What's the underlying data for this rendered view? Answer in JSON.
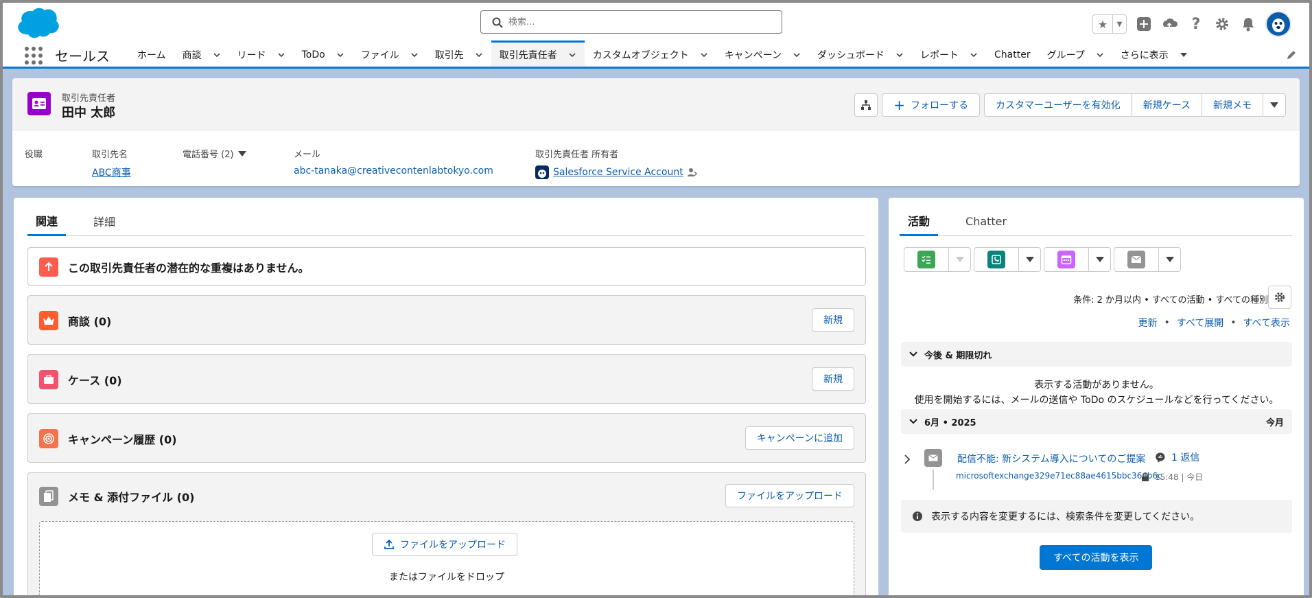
{
  "search": {
    "placeholder": "検索..."
  },
  "app": {
    "name": "セールス"
  },
  "nav": {
    "items": [
      {
        "label": "ホーム",
        "chevron": false
      },
      {
        "label": "商談",
        "chevron": true
      },
      {
        "label": "リード",
        "chevron": true
      },
      {
        "label": "ToDo",
        "chevron": true
      },
      {
        "label": "ファイル",
        "chevron": true
      },
      {
        "label": "取引先",
        "chevron": true
      },
      {
        "label": "取引先責任者",
        "chevron": true,
        "active": true
      },
      {
        "label": "カスタムオブジェクト",
        "chevron": true
      },
      {
        "label": "キャンペーン",
        "chevron": true
      },
      {
        "label": "ダッシュボード",
        "chevron": true
      },
      {
        "label": "レポート",
        "chevron": true
      },
      {
        "label": "Chatter",
        "chevron": false
      },
      {
        "label": "グループ",
        "chevron": true
      },
      {
        "label": "さらに表示",
        "chevron": "caret"
      }
    ]
  },
  "record": {
    "type": "取引先責任者",
    "name": "田中 太郎",
    "actions": {
      "follow": "フォローする",
      "enable_customer": "カスタマーユーザーを有効化",
      "new_case": "新規ケース",
      "new_note": "新規メモ"
    },
    "fields": {
      "title_label": "役職",
      "account_label": "取引先名",
      "account_value": "ABC商事",
      "phone_label": "電話番号 (2)",
      "email_label": "メール",
      "email_value": "abc-tanaka@creativecontenlabtokyo.com",
      "owner_label": "取引先責任者 所有者",
      "owner_value": "Salesforce Service Account"
    }
  },
  "left": {
    "tabs": [
      "関連",
      "詳細"
    ],
    "duplicate_msg": "この取引先責任者の潜在的な重複はありません。",
    "cards": {
      "opps": {
        "title": "商談 (0)",
        "button": "新規"
      },
      "cases": {
        "title": "ケース (0)",
        "button": "新規"
      },
      "campaign": {
        "title": "キャンペーン履歴 (0)",
        "button": "キャンペーンに追加"
      },
      "notes": {
        "title": "メモ & 添付ファイル (0)",
        "button": "ファイルをアップロード",
        "upload": "ファイルをアップロード",
        "drop": "またはファイルをドロップ"
      }
    }
  },
  "activity": {
    "tabs": [
      "活動",
      "Chatter"
    ],
    "filter": "条件: 2 か月以内 • すべての活動 • すべての種別",
    "links": {
      "refresh": "更新",
      "expand": "すべて展開",
      "show_all": "すべて表示"
    },
    "upcoming": "今後 & 期限切れ",
    "empty1": "表示する活動がありません。",
    "empty2": "使用を開始するには、メールの送信や ToDo のスケジュールなどを行ってください。",
    "month": "6月 • 2025",
    "month_right": "今月",
    "item": {
      "subject": "配信不能: 新システム導入についてのご提案",
      "reply": "1 返信",
      "from": "microsoftexchange329e71ec88ae4615bbc36ab6c",
      "time": "15:48 | 今日"
    },
    "info": "表示する内容を変更するには、検索条件を変更してください。",
    "view_all": "すべての活動を表示"
  },
  "colors": {
    "brand": "#0176d3",
    "link": "#0b5cab",
    "contact_icon": "#9602c7"
  }
}
